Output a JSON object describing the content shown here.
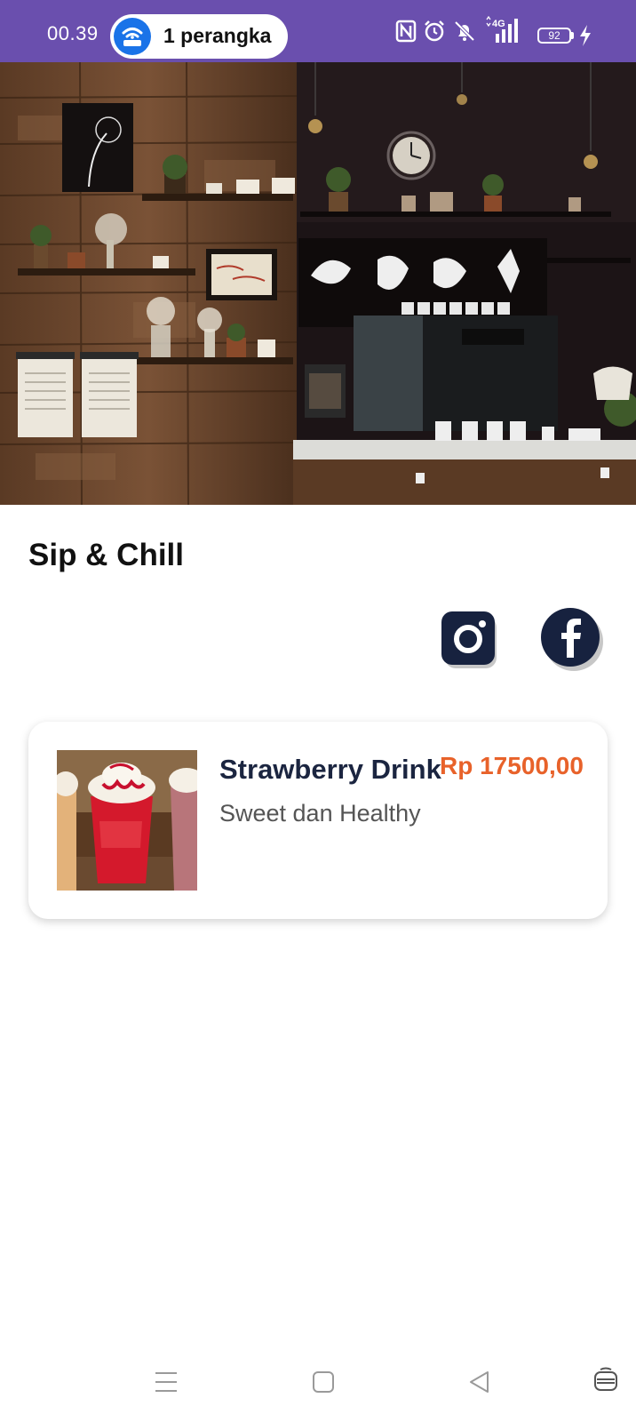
{
  "status_bar": {
    "time": "00.39",
    "hotspot_label": "1 perangka",
    "battery": "92"
  },
  "shop": {
    "title": "Sip & Chill"
  },
  "social": {
    "instagram_icon": "instagram-icon",
    "facebook_icon": "facebook-icon"
  },
  "menu_items": [
    {
      "name": "Strawberry Drink",
      "price": "Rp 17500,00",
      "description": "Sweet dan Healthy"
    }
  ],
  "colors": {
    "status_bar": "#6a4fae",
    "price": "#e8622a",
    "social_bg": "#17223f"
  }
}
